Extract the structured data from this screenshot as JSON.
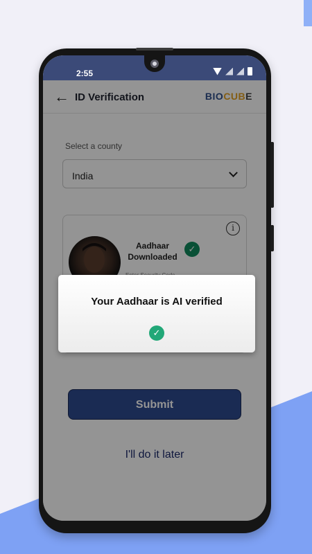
{
  "status_bar": {
    "time": "2:55",
    "icons": [
      "wifi-icon",
      "signal-icon",
      "signal-icon",
      "battery-icon"
    ]
  },
  "app_bar": {
    "title": "ID Verification",
    "back_icon": "back-arrow-icon",
    "logo": {
      "part1": "BIO",
      "part2": "CUB",
      "part3": "E"
    }
  },
  "form": {
    "country_label": "Select a county",
    "country_value": "India"
  },
  "card": {
    "title": "Aadhaar Downloaded",
    "subtitle": "Enter Security Code",
    "info_icon": "info-icon",
    "status_icon": "check-circle-icon"
  },
  "actions": {
    "submit_label": "Submit",
    "later_label": "I'll do it later"
  },
  "dialog": {
    "message": "Your Aadhaar is AI verified",
    "icon": "check-circle-icon"
  },
  "colors": {
    "status_bar": "#3b4a78",
    "primary_button": "#2e4a8f",
    "success": "#22a878",
    "background_accent": "#7ea1f4"
  }
}
